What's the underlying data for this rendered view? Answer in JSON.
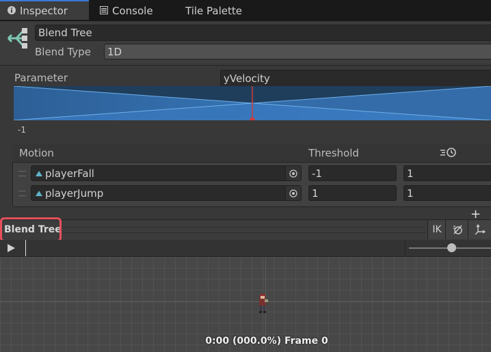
{
  "tabs": [
    {
      "label": "Inspector",
      "icon": "info-icon",
      "active": true
    },
    {
      "label": "Console",
      "icon": "console-icon",
      "active": false
    },
    {
      "label": "Tile Palette",
      "icon": "",
      "active": false
    }
  ],
  "header": {
    "node_icon": "blend-tree-icon",
    "name_value": "Blend Tree",
    "blend_type_label": "Blend Type",
    "blend_type_value": "1D"
  },
  "parameter": {
    "label": "Parameter",
    "value": "yVelocity",
    "min_label": "-1",
    "marker_fraction": 0.5
  },
  "motion_list": {
    "motion_header": "Motion",
    "threshold_header": "Threshold",
    "rows": [
      {
        "motion": "playerFall",
        "threshold": "-1",
        "speed": "1"
      },
      {
        "motion": "playerJump",
        "threshold": "1",
        "speed": "1"
      }
    ],
    "add_label": "+"
  },
  "preview": {
    "title": "Blend Tree",
    "ik_label": "IK",
    "frame_info": "0:00 (000.0%) Frame 0",
    "colors": {
      "highlight": "#e8505b",
      "blend_fill": "#3a78bd",
      "marker": "#d33a3a"
    }
  }
}
